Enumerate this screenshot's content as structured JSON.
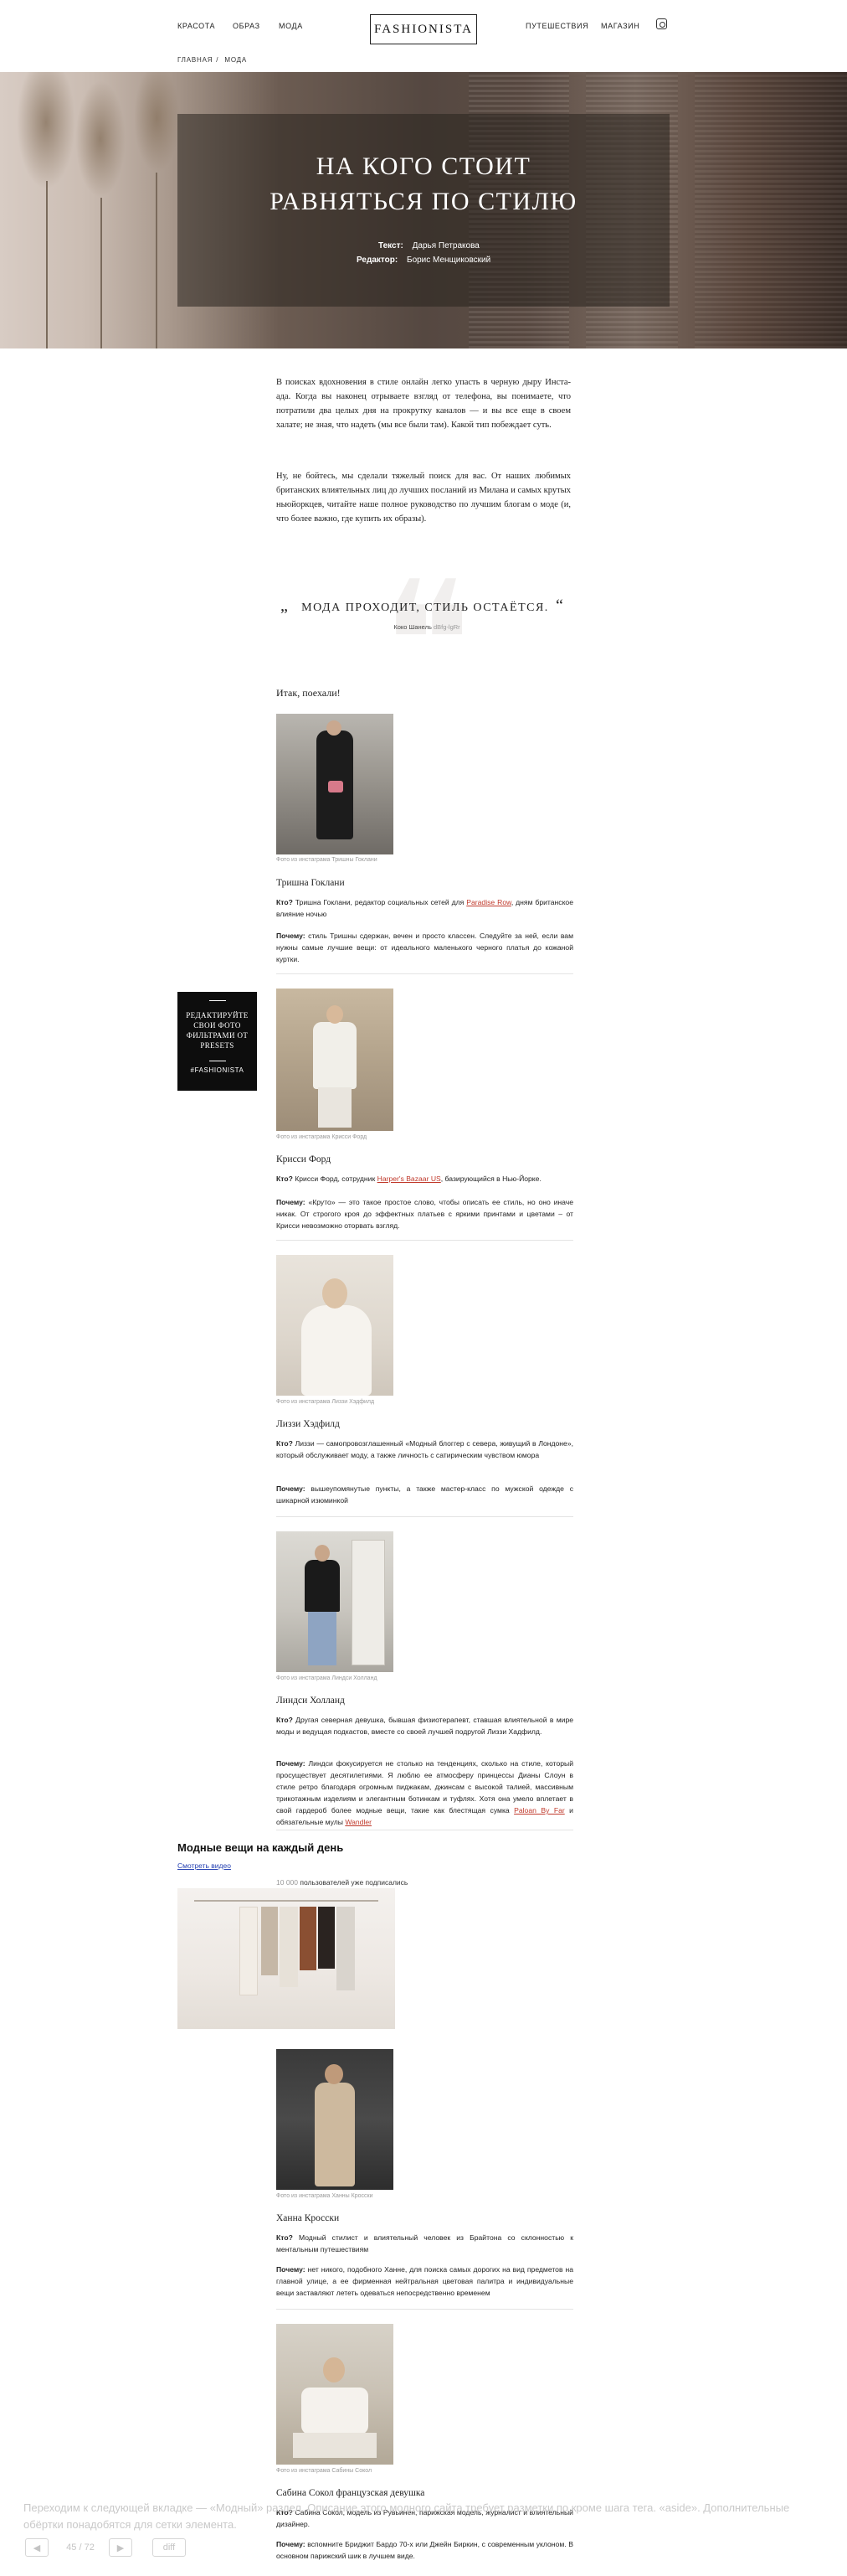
{
  "nav": {
    "left": [
      "КРАСОТА",
      "ОБРАЗ",
      "МОДА"
    ],
    "logo": "FASHIONISTA",
    "right": [
      "ПУТЕШЕСТВИЯ",
      "МАГАЗИН"
    ],
    "instagram_icon": "instagram-icon"
  },
  "breadcrumb": {
    "home": "ГЛАВНАЯ",
    "sep": "/",
    "current": "МОДА"
  },
  "hero": {
    "title_line1": "НА КОГО СТОИТ",
    "title_line2": "РАВНЯТЬСЯ ПО СТИЛЮ",
    "text_label": "Текст:",
    "text_author": "Дарья Петракова",
    "editor_label": "Редактор:",
    "editor_name": "Борис Менщиковский"
  },
  "intro": {
    "p1": "В поисках вдохновения в стиле онлайн легко упасть в черную дыру Инста-ада. Когда вы наконец отрываете взгляд от телефона, вы понимаете, что потратили два целых дня на прокрутку каналов — и вы все еще в своем халате; не зная, что надеть (мы все были там). Какой тип побеждает суть.",
    "p2": "Ну, не бойтесь, мы сделали тяжелый поиск для вас. От наших любимых британских влиятельных лиц до лучших посланий из Милана и самых крутых ньюйоркцев, читайте наше полное руководство по лучшим блогам о моде (и, что более важно, где купить их образы)."
  },
  "quote": {
    "open": "„",
    "close": "“",
    "text": "МОДА ПРОХОДИТ, СТИЛЬ ОСТАЁТСЯ.",
    "author": "Коко Шанель",
    "source": "dBfg-lgRr"
  },
  "lead": "Итак, поехали!",
  "influencers": [
    {
      "caption": "Фото из инстаграма Тришны Гоклани",
      "name": "Тришна Гоклани",
      "who_label": "Кто?",
      "who_text": " Тришна Гоклани, редактор социальных сетей для ",
      "who_link": "Paradise Row",
      "who_tail": ", дням британское влияние ночью",
      "why_label": "Почему:",
      "why_text": " стиль Тришны сдержан, вечен и просто классен. Следуйте за ней, если вам нужны самые лучшие вещи: от идеального маленького черного платья до кожаной куртки."
    },
    {
      "caption": "Фото из инстаграма Крисси Форд",
      "name": "Крисси Форд",
      "who_label": "Кто?",
      "who_text": " Крисси Форд, сотрудник ",
      "who_link": "Harper's Bazaar US",
      "who_tail": ", базирующийся в Нью-Йорке.",
      "why_label": "Почему:",
      "why_text": " «Круто» — это такое простое слово, чтобы описать ее стиль, но оно иначе никак. От строгого кроя до эффектных платьев с яркими принтами и цветами – от Крисси невозможно оторвать взгляд."
    },
    {
      "caption": "Фото из инстаграма Лиззи Хэдфилд",
      "name": "Лиззи Хэдфилд",
      "who_label": "Кто?",
      "who_text": " Лиззи — самопровозглашенный «Модный блоггер с севера, живущий в Лондоне», который обслуживает моду, а также личность с сатирическим чувством юмора",
      "who_link": "",
      "who_tail": "",
      "why_label": "Почему:",
      "why_text": " вышеупомянутые пункты, а также мастер-класс по мужской одежде с шикарной изюминкой"
    },
    {
      "caption": "Фото из инстаграма Линдси Холланд",
      "name": "Линдси Холланд",
      "who_label": "Кто?",
      "who_text": " Другая северная девушка, бывшая физиотерапевт, ставшая влиятельной в мире моды и ведущая подкастов, вместе со своей лучшей подругой Лиззи Хадфилд.",
      "who_link": "",
      "who_tail": "",
      "why_label": "Почему:",
      "why_text": " Линдси фокусируется не столько на тенденциях, сколько на стиле, который просуществует десятилетиями. Я люблю ее атмосферу принцессы Дианы Слоун в стиле ретро благодаря огромным пиджакам, джинсам с высокой талией, массивным трикотажным изделиям и элегантным ботинкам и туфлях. Хотя она умело вплетает в свой гардероб более модные вещи, такие как блестящая сумка ",
      "why_link1": "Paloan By Far",
      "why_mid": " и обязательные мулы ",
      "why_link2": "Wandler"
    }
  ],
  "promo": {
    "text": "РЕДАКТИРУЙТЕ СВОИ ФОТО ФИЛЬТРАМИ ОТ PRESETS",
    "tag": "#FASHIONISTA"
  },
  "daily": {
    "heading": "Модные вещи на каждый день",
    "video_link": "Смотреть видео",
    "subs_num": "10 000",
    "subs_text": " пользователей уже подписались"
  },
  "influencers2": [
    {
      "caption": "Фото из инстаграма Ханны Кросски",
      "name": "Ханна Кросски",
      "who_label": "Кто?",
      "who_text": " Модный стилист и влиятельный человек из Брайтона со склонностью к ментальным путешествиям",
      "why_label": "Почему:",
      "why_text": " нет никого, подобного Ханне, для поиска самых дорогих на вид предметов на главной улице, а ее фирменная нейтральная цветовая палитра и индивидуальные вещи заставляют лететь одеваться непосредственно временем"
    },
    {
      "caption": "Фото из инстаграма Сабины Сокол",
      "name": "Сабина Сокол французская девушка",
      "who_label": "Кто?",
      "who_text": " Сабина Сокол, модель из Рувьинен, парижская модель, журналист и влиятельный дизайнер.",
      "why_label": "Почему:",
      "why_text": " вспомните Бриджит Бардо 70-х или Джейн Биркин, с современным уклоном. В основном парижский шик в лучшем виде."
    }
  ],
  "overlay": {
    "text": "Переходим к следующей вкладке — «Модный» раздел. Описание этого модного сайта требует разметки по кроме шага тега. «aside». Дополнительные обёртки понадобятся для сетки элемента.",
    "pager_prev": "◀",
    "pager_num": "45 / 72",
    "pager_next": "▶",
    "pager_diff": "diff"
  },
  "colors": {
    "accent_link": "#c0392b",
    "blue_link": "#2541b2",
    "promo_bg": "#0d0d0d"
  }
}
